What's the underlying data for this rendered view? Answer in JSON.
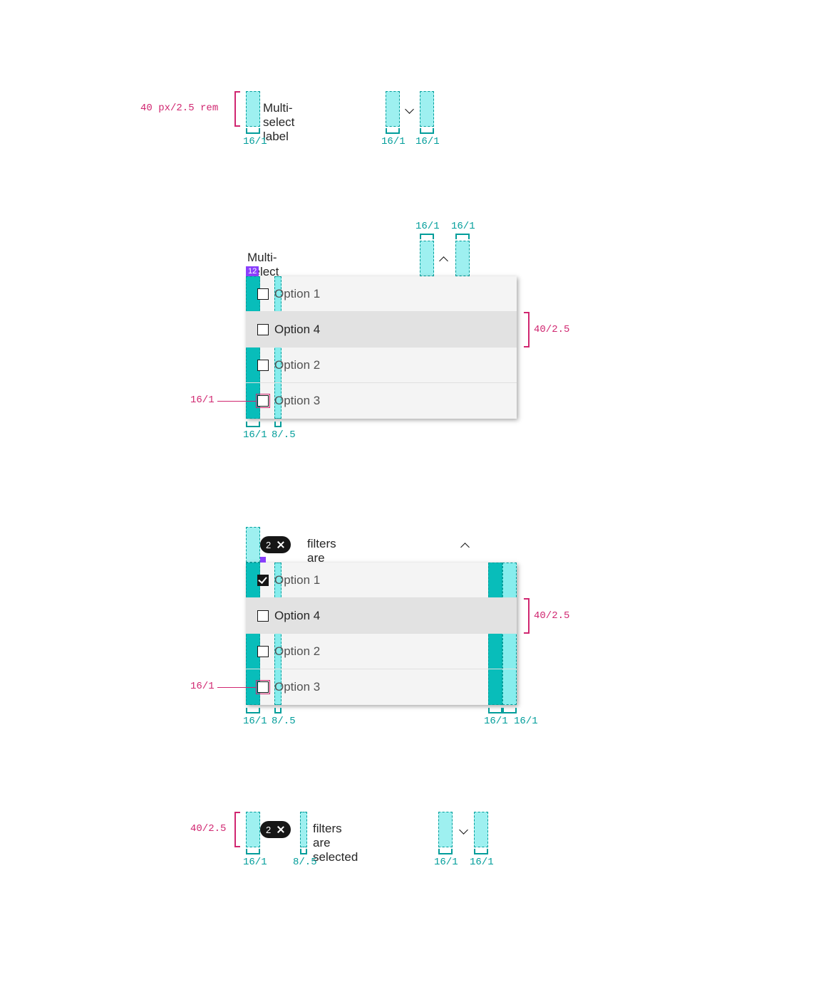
{
  "spec_colors": {
    "cyan_fill": "#9ef0f0",
    "cyan_border": "#009d9a",
    "cyan_strong": "#08bdba",
    "pink": "#d02670",
    "purple": "#8a3ffc"
  },
  "example1": {
    "label": "Multi-select label",
    "height_spec": "40 px/2.5 rem",
    "pads": {
      "left": "16/1",
      "gap_chevron_left": "16/1",
      "gap_chevron_right": "16/1"
    }
  },
  "example2": {
    "label": "Multi-select label",
    "badge": "12",
    "top_pads": {
      "chevron_left": "16/1",
      "chevron_right": "16/1"
    },
    "row_height": "40/2.5",
    "checkbox_size": "16/1",
    "row_pads": {
      "left": "16/1",
      "after_checkbox": "8/.5"
    },
    "options": [
      {
        "label": "Option 1",
        "checked": false,
        "state": "default"
      },
      {
        "label": "Option 4",
        "checked": false,
        "state": "hover"
      },
      {
        "label": "Option 2",
        "checked": false,
        "state": "default"
      },
      {
        "label": "Option 3",
        "checked": false,
        "state": "default",
        "callout": true
      }
    ]
  },
  "example3": {
    "tag_count": "2",
    "summary_label": "filters are selected",
    "row_height": "40/2.5",
    "checkbox_size": "16/1",
    "row_pads": {
      "left": "16/1",
      "after_checkbox": "8/.5",
      "right_inner": "16/1",
      "right_outer": "16/1"
    },
    "options": [
      {
        "label": "Option 1",
        "checked": true,
        "state": "default"
      },
      {
        "label": "Option 4",
        "checked": false,
        "state": "hover"
      },
      {
        "label": "Option 2",
        "checked": false,
        "state": "default"
      },
      {
        "label": "Option 3",
        "checked": false,
        "state": "default",
        "callout": true
      }
    ]
  },
  "example4": {
    "tag_count": "2",
    "summary_label": "filters are selected",
    "height_spec": "40/2.5",
    "pads": {
      "left": "16/1",
      "after_tag": "8/.5",
      "chevron_left": "16/1",
      "chevron_right": "16/1"
    }
  }
}
